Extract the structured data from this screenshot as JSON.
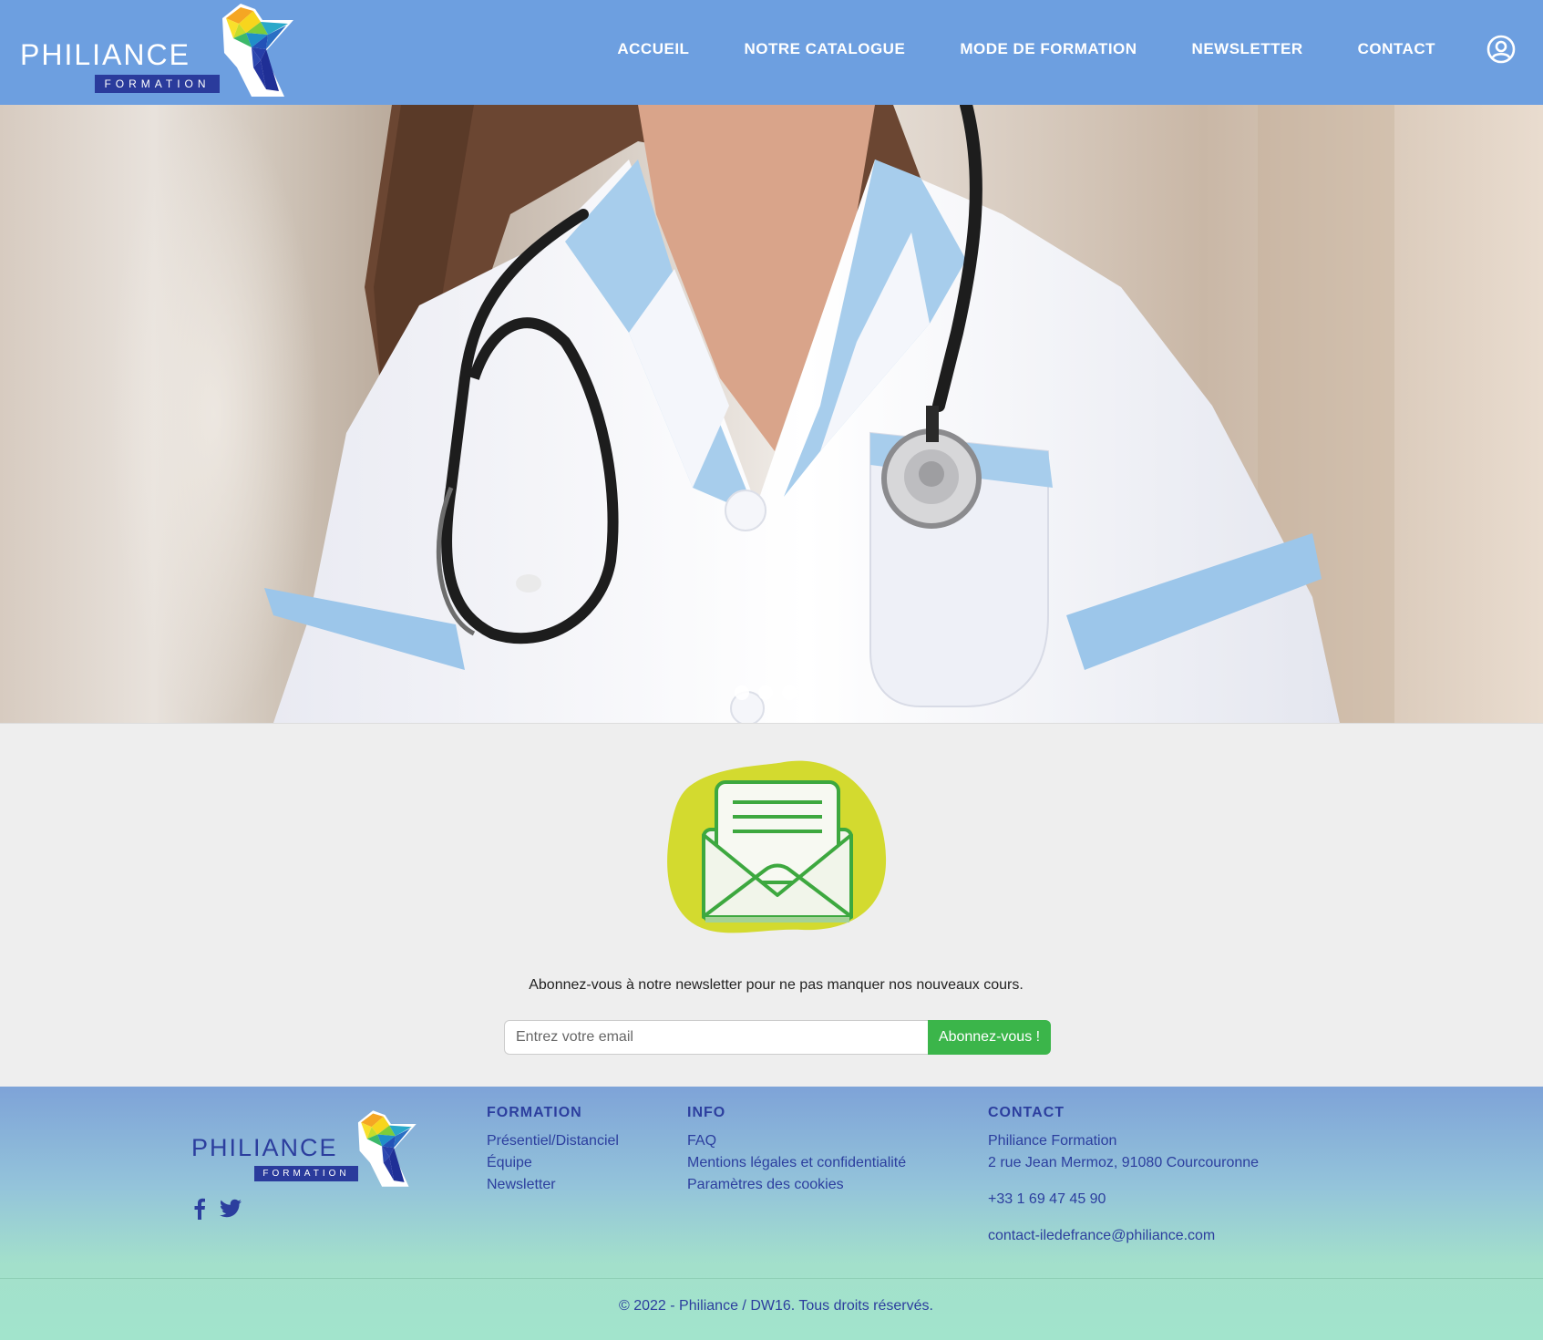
{
  "colors": {
    "header": "#6d9fe0",
    "accent_green": "#3bb54a",
    "footer_text": "#2c3e9e"
  },
  "header": {
    "logo_text": "PHILIANCE",
    "logo_sub": "FORMATION",
    "nav": [
      {
        "label": "ACCUEIL"
      },
      {
        "label": "NOTRE CATALOGUE"
      },
      {
        "label": "MODE DE FORMATION"
      },
      {
        "label": "NEWSLETTER"
      },
      {
        "label": "CONTACT"
      }
    ],
    "user_icon": "user-circle-icon"
  },
  "hero": {
    "slides": 3,
    "active_slide": 1
  },
  "newsletter": {
    "icon": "envelope-letter-icon",
    "text": "Abonnez-vous à notre newsletter pour ne pas manquer nos nouveaux cours.",
    "placeholder": "Entrez votre email",
    "button": "Abonnez-vous !"
  },
  "footer": {
    "logo_text": "PHILIANCE",
    "logo_sub": "FORMATION",
    "socials": [
      "facebook-icon",
      "twitter-icon"
    ],
    "formation": {
      "title": "FORMATION",
      "links": [
        "Présentiel/Distanciel",
        "Équipe",
        "Newsletter"
      ]
    },
    "info": {
      "title": "INFO",
      "links": [
        "FAQ",
        "Mentions légales et confidentialité",
        "Paramètres des cookies"
      ]
    },
    "contact": {
      "title": "CONTACT",
      "name": "Philiance Formation",
      "address": "2 rue Jean Mermoz, 91080 Courcouronne",
      "phone": "+33 1 69 47 45 90",
      "email": "contact-iledefrance@philiance.com"
    },
    "copyright": "© 2022 - Philiance / DW16. Tous droits réservés."
  }
}
